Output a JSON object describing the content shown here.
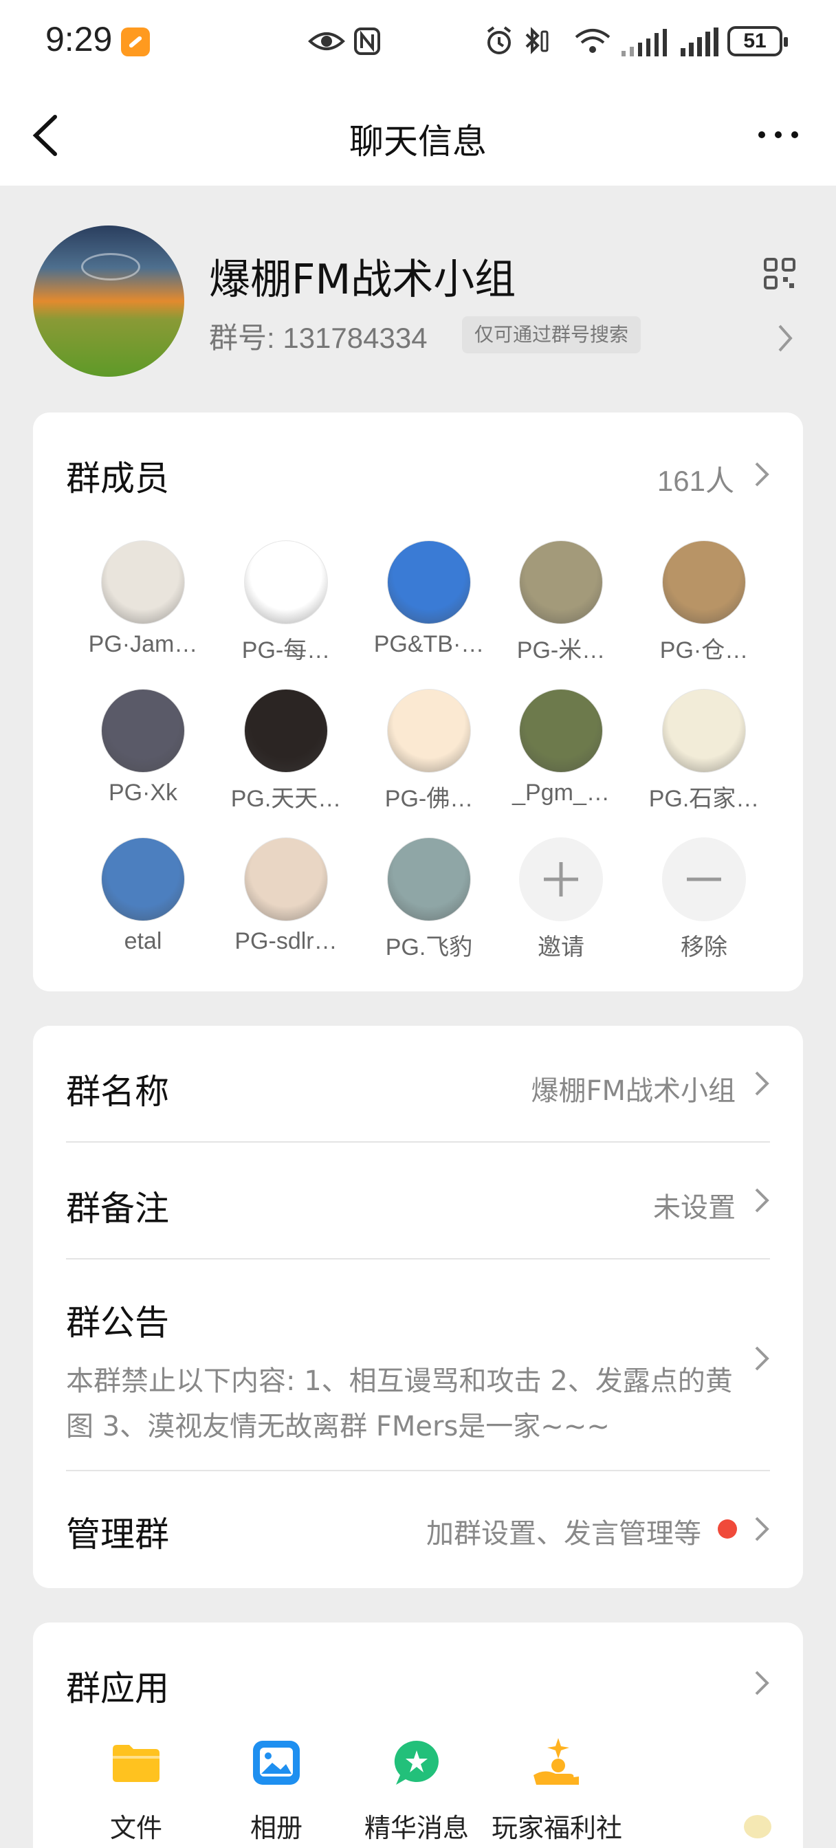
{
  "status_bar": {
    "time": "9:29",
    "battery": "51"
  },
  "nav": {
    "title": "聊天信息"
  },
  "group": {
    "name": "爆棚FM战术小组",
    "number_label": "群号:",
    "number": "131784334",
    "search_tag": "仅可通过群号搜索"
  },
  "members": {
    "title": "群成员",
    "count": "161人",
    "list": [
      {
        "name": "PG·Jam…",
        "color": "#e9e4dc"
      },
      {
        "name": "PG-每…",
        "color": "#ffffff"
      },
      {
        "name": "PG&TB·…",
        "color": "#3a7bd5"
      },
      {
        "name": "PG-米…",
        "color": "#a39a7a"
      },
      {
        "name": "PG·仓…",
        "color": "#b89466"
      },
      {
        "name": "PG·Xk",
        "color": "#5a5a68"
      },
      {
        "name": "PG.天天…",
        "color": "#2b2523"
      },
      {
        "name": "PG-佛…",
        "color": "#fbe9d2"
      },
      {
        "name": "_Pgm_…",
        "color": "#6d7a4c"
      },
      {
        "name": "PG.石家…",
        "color": "#f2ecd8"
      },
      {
        "name": "etal",
        "color": "#4c7fbf"
      },
      {
        "name": "PG-sdlr…",
        "color": "#e9d6c4"
      },
      {
        "name": "PG.飞豹",
        "color": "#8fa6a6"
      }
    ],
    "invite_label": "邀请",
    "remove_label": "移除"
  },
  "settings": {
    "name_label": "群名称",
    "name_value": "爆棚FM战术小组",
    "remark_label": "群备注",
    "remark_value": "未设置",
    "notice_label": "群公告",
    "notice_text": "本群禁止以下内容: 1、相互谩骂和攻击 2、发露点的黄图 3、漠视友情无故离群 FMers是一家~~~",
    "manage_label": "管理群",
    "manage_value": "加群设置、发言管理等"
  },
  "apps": {
    "title": "群应用",
    "items": [
      {
        "label": "文件",
        "icon": "folder-icon",
        "color": "#ffc21f"
      },
      {
        "label": "相册",
        "icon": "photo-album-icon",
        "color": "#1e8ff0"
      },
      {
        "label": "精华消息",
        "icon": "essence-message-icon",
        "color": "#22c07a"
      },
      {
        "label": "玩家福利社",
        "icon": "gift-hand-icon",
        "color": "#ffb21f"
      }
    ]
  },
  "colors": {
    "accent_red": "#f04a3a",
    "background": "#ededed"
  }
}
